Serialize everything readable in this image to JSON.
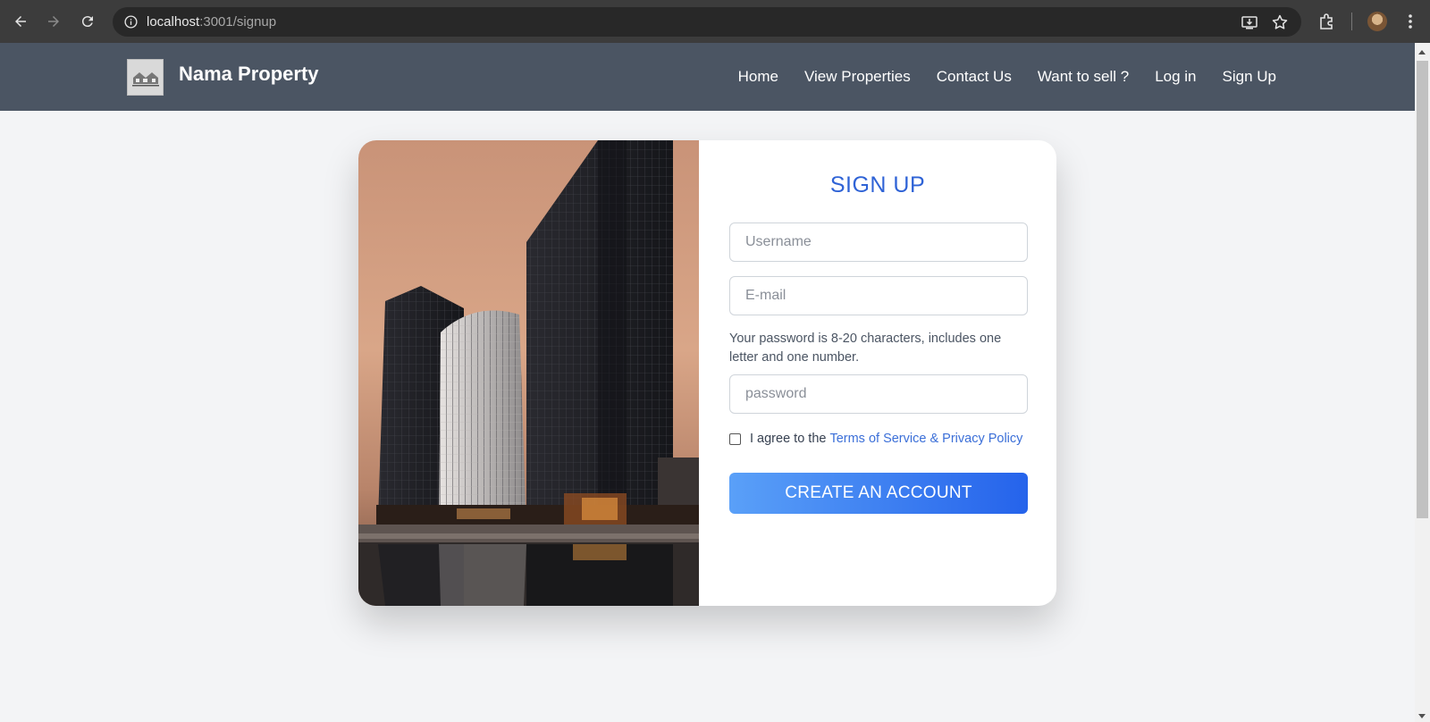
{
  "browser": {
    "url_host": "localhost",
    "url_path": ":3001/signup",
    "icons": [
      "back-arrow-icon",
      "forward-arrow-icon",
      "reload-icon",
      "site-info-icon",
      "install-app-icon",
      "bookmark-star-icon",
      "extensions-icon",
      "profile-avatar-icon",
      "more-menu-icon"
    ]
  },
  "site": {
    "brand": "Nama Property",
    "nav": [
      "Home",
      "View Properties",
      "Contact Us",
      "Want to sell ?",
      "Log in",
      "Sign Up"
    ]
  },
  "signup": {
    "title": "SIGN UP",
    "username_placeholder": "Username",
    "email_placeholder": "E-mail",
    "password_hint": "Your password is 8-20 characters, includes one letter and one number.",
    "password_placeholder": "password",
    "agree_text": "I agree to the",
    "terms_link": "Terms of Service & Privacy Policy",
    "submit_label": "CREATE AN ACCOUNT",
    "colors": {
      "title": "#2f63d6",
      "button_start": "#5aa0f8",
      "button_end": "#2563eb",
      "header": "#4b5563",
      "page_bg": "#f3f4f6"
    }
  }
}
